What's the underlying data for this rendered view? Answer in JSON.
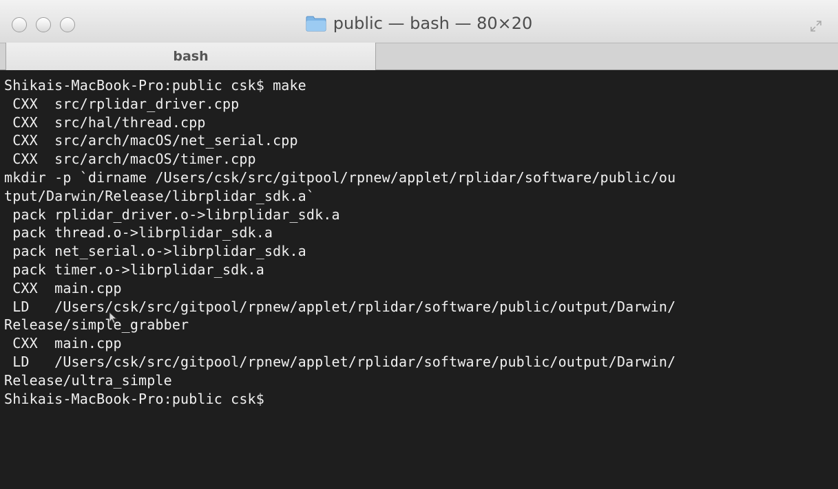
{
  "window": {
    "title": "public — bash — 80×20",
    "folder_icon": "folder-icon",
    "fullscreen_icon": "fullscreen-arrows-icon",
    "traffic_lights": [
      "close-button",
      "minimize-button",
      "zoom-button"
    ]
  },
  "tabs": [
    {
      "label": "bash",
      "active": true
    }
  ],
  "terminal": {
    "lines": [
      "Shikais-MacBook-Pro:public csk$ make",
      " CXX  src/rplidar_driver.cpp",
      " CXX  src/hal/thread.cpp",
      " CXX  src/arch/macOS/net_serial.cpp",
      " CXX  src/arch/macOS/timer.cpp",
      "mkdir -p `dirname /Users/csk/src/gitpool/rpnew/applet/rplidar/software/public/ou",
      "tput/Darwin/Release/librplidar_sdk.a`",
      " pack rplidar_driver.o->librplidar_sdk.a",
      " pack thread.o->librplidar_sdk.a",
      " pack net_serial.o->librplidar_sdk.a",
      " pack timer.o->librplidar_sdk.a",
      " CXX  main.cpp",
      " LD   /Users/csk/src/gitpool/rpnew/applet/rplidar/software/public/output/Darwin/",
      "Release/simple_grabber",
      " CXX  main.cpp",
      " LD   /Users/csk/src/gitpool/rpnew/applet/rplidar/software/public/output/Darwin/",
      "Release/ultra_simple",
      "Shikais-MacBook-Pro:public csk$",
      "",
      ""
    ]
  },
  "colors": {
    "terminal_bg": "#1e1e1e",
    "terminal_fg": "#f0f0f0",
    "titlebar_top": "#f2f2f2",
    "titlebar_bottom": "#dcdcdc"
  }
}
